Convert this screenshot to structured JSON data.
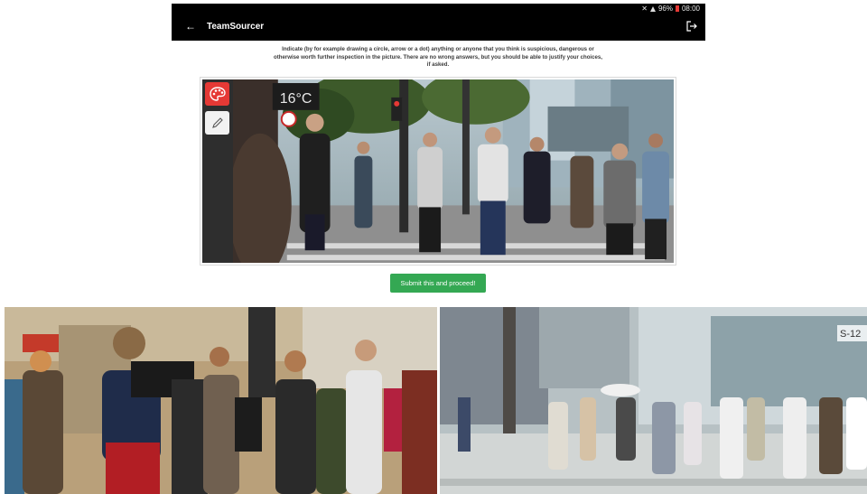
{
  "statusbar": {
    "battery": "96%",
    "time": "08:00"
  },
  "appbar": {
    "back_glyph": "←",
    "title": "TeamSourcer"
  },
  "instructions": "Indicate (by for example drawing a circle, arrow or a dot) anything or anyone that you think is suspicious, dangerous or otherwise worth further inspection in the picture. There are no wrong answers, but you should be able to justify your choices, if asked.",
  "scene": {
    "temperature": "16°C"
  },
  "right_photo": {
    "sign": "S-12"
  },
  "submit_label": "Submit this and proceed!",
  "colors": {
    "accent_green": "#34a853",
    "palette_red": "#e53935",
    "appbar_black": "#000000"
  },
  "icons": [
    "back-arrow-icon",
    "logout-icon",
    "palette-icon",
    "pencil-icon",
    "wifi-icon",
    "battery-icon",
    "mute-icon"
  ]
}
